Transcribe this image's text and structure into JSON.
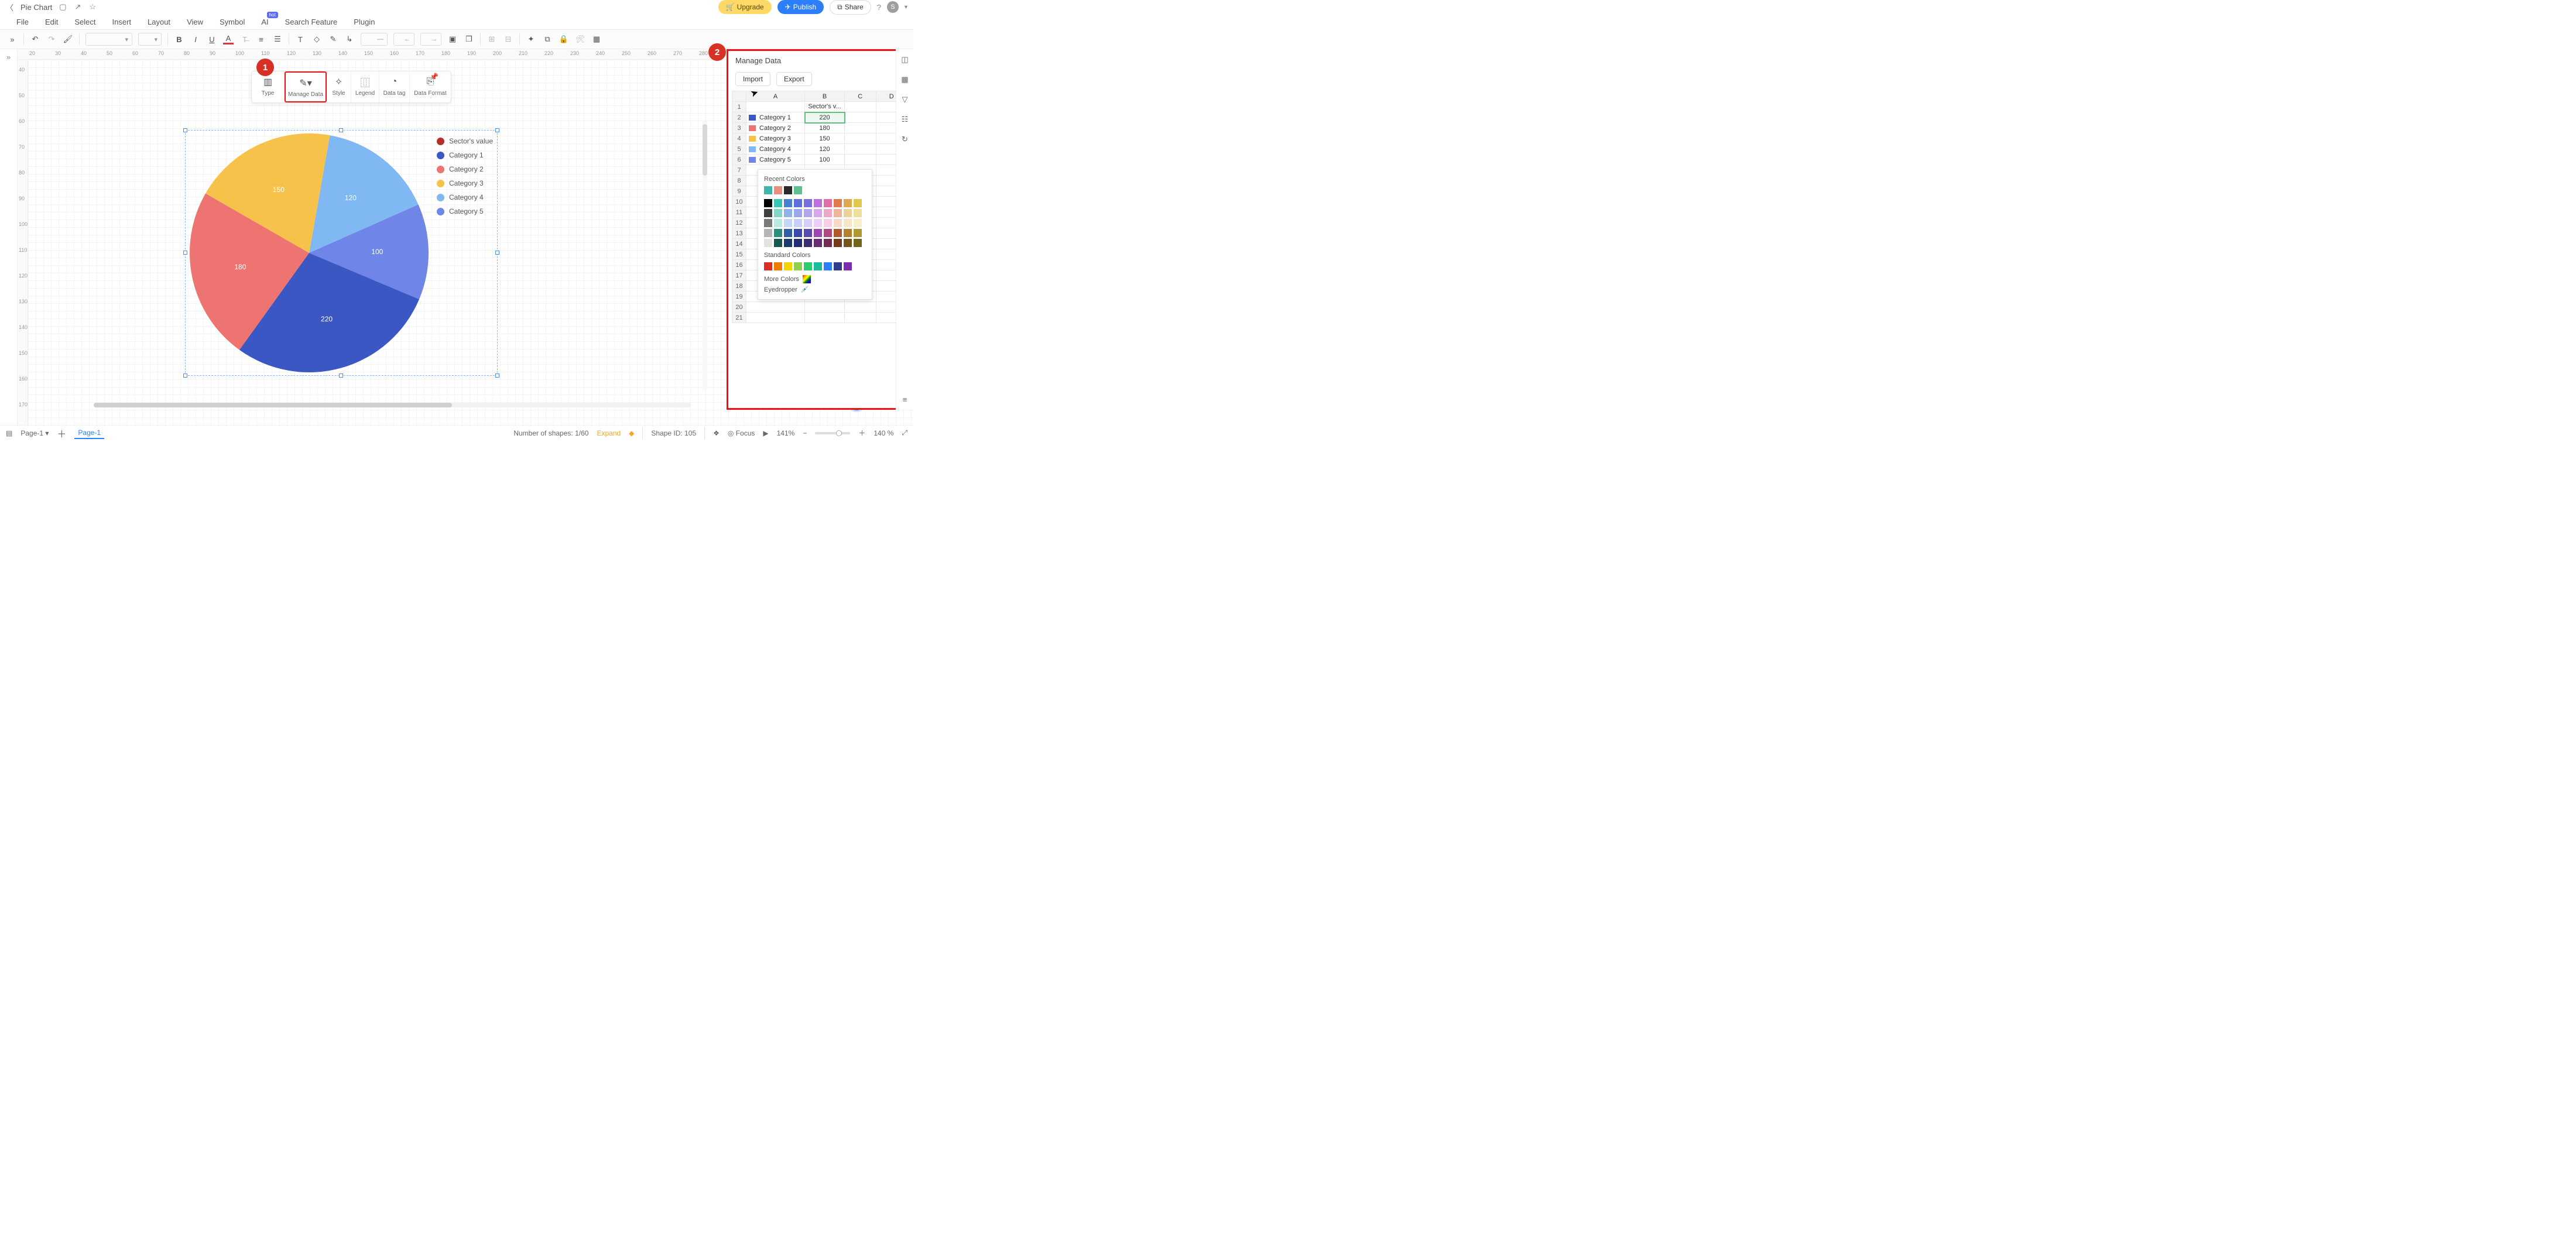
{
  "titlebar": {
    "doc_title": "Pie Chart",
    "upgrade": "Upgrade",
    "publish": "Publish",
    "share": "Share",
    "avatar_initial": "S"
  },
  "menubar": {
    "file": "File",
    "edit": "Edit",
    "select": "Select",
    "insert": "Insert",
    "layout": "Layout",
    "view": "View",
    "symbol": "Symbol",
    "ai": "AI",
    "ai_badge": "hot",
    "search_feature": "Search Feature",
    "plugin": "Plugin"
  },
  "ruler_h": [
    "20",
    "30",
    "40",
    "50",
    "60",
    "70",
    "80",
    "90",
    "100",
    "110",
    "120",
    "130",
    "140",
    "150",
    "160",
    "170",
    "180",
    "190",
    "200",
    "210",
    "220",
    "230",
    "240",
    "250",
    "260",
    "270",
    "280"
  ],
  "ruler_v": [
    "40",
    "50",
    "60",
    "70",
    "80",
    "90",
    "100",
    "110",
    "120",
    "130",
    "140",
    "150",
    "160",
    "170"
  ],
  "floating_toolbar": {
    "type": "Type",
    "manage_data": "Manage Data",
    "style": "Style",
    "legend": "Legend",
    "data_tag": "Data tag",
    "data_format": "Data Format"
  },
  "callouts": {
    "one": "1",
    "two": "2"
  },
  "chart_data": {
    "type": "pie",
    "categories": [
      "Category 1",
      "Category 2",
      "Category 3",
      "Category 4",
      "Category 5"
    ],
    "values": [
      220,
      180,
      150,
      120,
      100
    ],
    "colors": [
      "#3a57c4",
      "#ed7470",
      "#f7c24a",
      "#7fb8f2",
      "#6f86e8"
    ],
    "legend_title": "Sector's value",
    "legend_title_color": "#b52f2a",
    "show_data_labels": true
  },
  "panel": {
    "title": "Manage Data",
    "import": "Import",
    "export": "Export",
    "columns": [
      "A",
      "B",
      "C",
      "D"
    ],
    "row_header": "Sector's v...",
    "rows": [
      {
        "n": "1",
        "label": "",
        "value": ""
      },
      {
        "n": "2",
        "label": "Category 1",
        "value": "220",
        "color": "#3a57c4",
        "editing": true
      },
      {
        "n": "3",
        "label": "Category 2",
        "value": "180",
        "color": "#ed7470"
      },
      {
        "n": "4",
        "label": "Category 3",
        "value": "150",
        "color": "#f7c24a"
      },
      {
        "n": "5",
        "label": "Category 4",
        "value": "120",
        "color": "#7fb8f2"
      },
      {
        "n": "6",
        "label": "Category 5",
        "value": "100",
        "color": "#6f86e8"
      }
    ],
    "extra_rows": [
      "7",
      "8",
      "9",
      "10",
      "11",
      "12",
      "13",
      "14",
      "15",
      "16",
      "17",
      "18",
      "19",
      "20",
      "21"
    ]
  },
  "color_popup": {
    "recent": "Recent Colors",
    "recent_sw": [
      "#3fb6a8",
      "#e98f82",
      "#2b2b2b",
      "#5fc08d"
    ],
    "standard": "Standard Colors",
    "standard_sw": [
      "#d93025",
      "#f07c00",
      "#f7d300",
      "#8fd14f",
      "#2ecc71",
      "#1bbc9b",
      "#2d7ff9",
      "#2f3c8f",
      "#7b2fb0"
    ],
    "more": "More Colors",
    "eyedropper": "Eyedropper",
    "grid_colors": [
      [
        "#000000",
        "#36c5b0",
        "#4a7fd6",
        "#5b6fe0",
        "#7a6fe0",
        "#c06fe0",
        "#e06fa7",
        "#e07a4f",
        "#e0a84f",
        "#e0c84f"
      ],
      [
        "#404040",
        "#7fd6c9",
        "#8fb3e8",
        "#9aa6ee",
        "#b0a6ee",
        "#d9a6ee",
        "#eea6cb",
        "#eeb69a",
        "#eed09a",
        "#eedf9a"
      ],
      [
        "#7a7a7a",
        "#b7eae2",
        "#c3d7f4",
        "#c8cef7",
        "#d6cef7",
        "#edcef7",
        "#f7cee3",
        "#f7d9c8",
        "#f7e6c8",
        "#f7efc8"
      ],
      [
        "#b5b5b5",
        "#2a8f82",
        "#2f5fa8",
        "#3a49b0",
        "#5a49b0",
        "#9a49b0",
        "#b04980",
        "#b05a2f",
        "#b0812f",
        "#b09a2f"
      ],
      [
        "#e3e3e3",
        "#16584f",
        "#1c3a6b",
        "#232d73",
        "#3a2d73",
        "#662d73",
        "#732d52",
        "#733a1c",
        "#73551c",
        "#73661c"
      ]
    ]
  },
  "status": {
    "page_label": "Page-1",
    "tab": "Page-1",
    "shapes_label": "Number of shapes:",
    "shapes_value": "1/60",
    "expand": "Expand",
    "shape_id_label": "Shape ID:",
    "shape_id": "105",
    "focus": "Focus",
    "zoom_pct": "141%",
    "zoom_display": "140 %"
  }
}
